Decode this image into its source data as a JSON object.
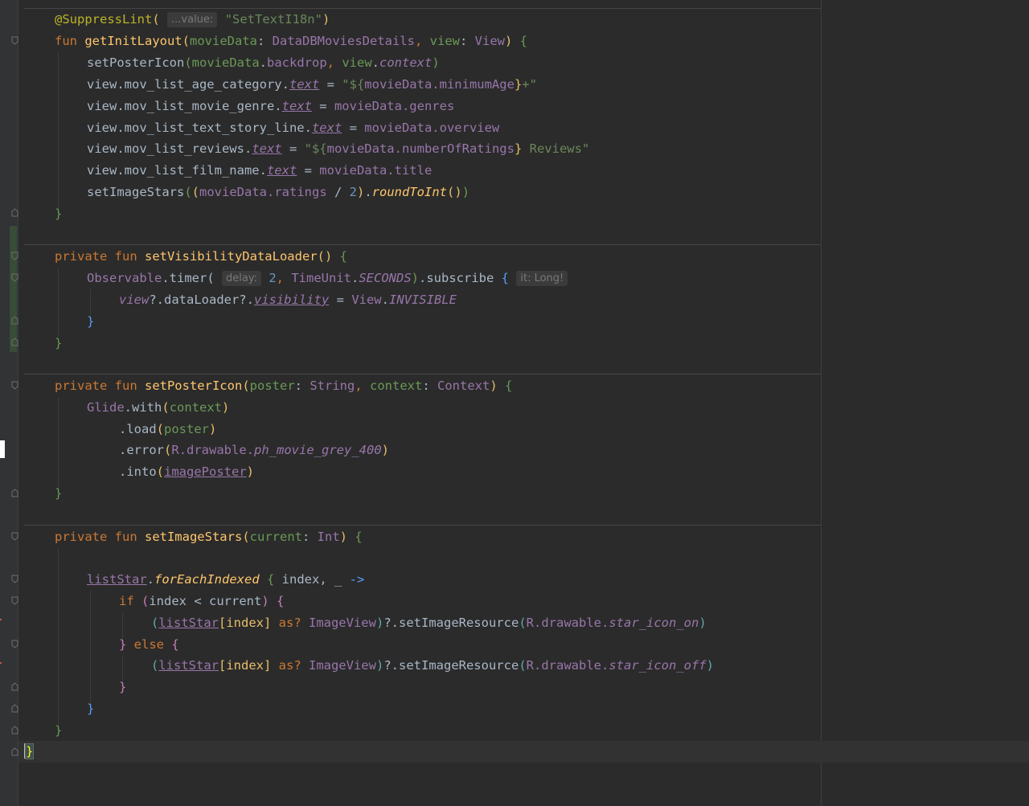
{
  "editor": {
    "annotation": "@SuppressLint",
    "hint_value": "...value:",
    "suppress_value": "\"SetTextI18n\"",
    "hint_delay": "delay:",
    "hint_it": "it: Long!",
    "lines": {
      "l1_fun": "fun ",
      "l1_name": "getInitLayout",
      "l1_p1": "movieData",
      "l1_t1": "DataDBMoviesDetails",
      "l1_p2": "view",
      "l1_t2": "View",
      "l2_call": "setPosterIcon",
      "l2_a1": "movieData",
      "l2_a1p": "backdrop",
      "l2_a2": "view",
      "l2_a2p": "context",
      "l3_recv": "view.mov_list_age_category.",
      "l3_prop": "text",
      "l3_tmpl_open": "\"${",
      "l3_expr": "movieData.minimumAge",
      "l3_tmpl_close": "}",
      "l3_tail": "+\"",
      "l4_recv": "view.mov_list_movie_genre.",
      "l4_prop": "text",
      "l4_val": "movieData.genres",
      "l5_recv": "view.mov_list_text_story_line.",
      "l5_prop": "text",
      "l5_val": "movieData.overview",
      "l6_recv": "view.mov_list_reviews.",
      "l6_prop": "text",
      "l6_tmpl_open": "\"${",
      "l6_expr": "movieData.numberOfRatings",
      "l6_tmpl_close": "}",
      "l6_tail": " Reviews\"",
      "l7_recv": "view.mov_list_film_name.",
      "l7_prop": "text",
      "l7_val": "movieData.title",
      "l8_call": "setImageStars",
      "l8_expr": "movieData.ratings",
      "l8_div": " / ",
      "l8_num": "2",
      "l8_ext": "roundToInt",
      "f2_private": "private fun ",
      "f2_name": "setVisibilityDataLoader",
      "f2_obs": "Observable",
      "f2_timer": ".timer(",
      "f2_num": "2",
      "f2_unit": "TimeUnit",
      "f2_unit_const": "SECONDS",
      "f2_subscribe": ".subscribe",
      "f2_view": "view",
      "f2_loader": "?.dataLoader?.",
      "f2_vis": "visibility",
      "f2_eq": " = ",
      "f2_view2": "View",
      "f2_invis": "INVISIBLE",
      "f3_private": "private fun ",
      "f3_name": "setPosterIcon",
      "f3_p1": "poster",
      "f3_t1": "String",
      "f3_p2": "context",
      "f3_t2": "Context",
      "f3_glide": "Glide",
      "f3_with": ".with",
      "f3_ctx": "context",
      "f3_load": ".load",
      "f3_poster": "poster",
      "f3_error": ".error",
      "f3_r": "R",
      "f3_drawable": ".drawable.",
      "f3_res": "ph_movie_grey_400",
      "f3_into": ".into",
      "f3_image": "imagePoster",
      "f4_private": "private fun ",
      "f4_name": "setImageStars",
      "f4_p1": "current",
      "f4_t1": "Int",
      "f4_list": "listStar",
      "f4_each": "forEachIndexed",
      "f4_index": " index, _ ",
      "f4_arrow": "->",
      "f4_if": "if ",
      "f4_cond": "index < current",
      "f4_list2": "listStar",
      "f4_idx": "[index] ",
      "f4_as": "as? ",
      "f4_iv": "ImageView",
      "f4_set": "?.setImageResource",
      "f4_r": "R",
      "f4_drawable": ".drawable.",
      "f4_on": "star_icon_on",
      "f4_else": " else ",
      "f4_off": "star_icon_off"
    }
  }
}
